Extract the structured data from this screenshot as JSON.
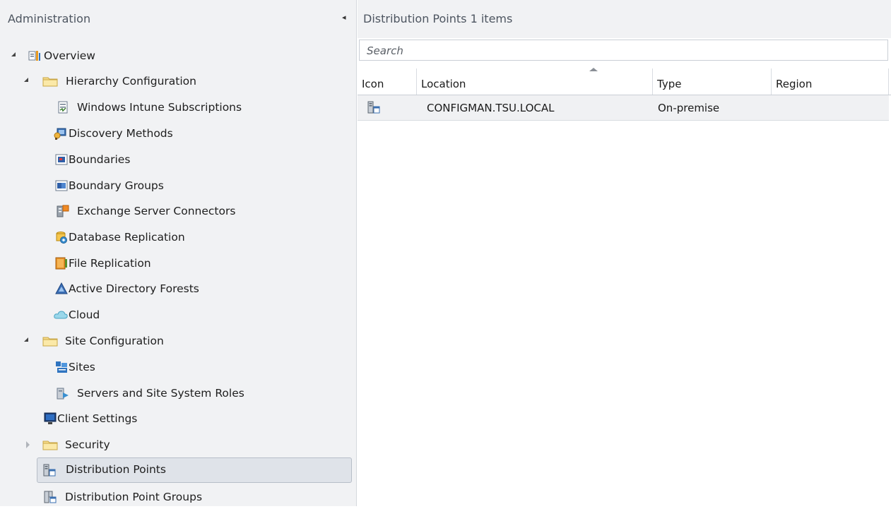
{
  "nav": {
    "title": "Administration",
    "collapse_glyph": "◂",
    "tree": [
      {
        "label": "Overview",
        "icon": "overview-icon",
        "expander": "open"
      },
      {
        "label": "Hierarchy Configuration",
        "icon": "folder-icon",
        "expander": "open"
      },
      {
        "label": "Windows Intune Subscriptions",
        "icon": "subscription-icon"
      },
      {
        "label": "Discovery Methods",
        "icon": "discovery-icon"
      },
      {
        "label": "Boundaries",
        "icon": "boundary-icon"
      },
      {
        "label": "Boundary Groups",
        "icon": "boundary-group-icon"
      },
      {
        "label": "Exchange Server Connectors",
        "icon": "exchange-connector-icon"
      },
      {
        "label": "Database Replication",
        "icon": "database-replication-icon"
      },
      {
        "label": "File Replication",
        "icon": "file-replication-icon"
      },
      {
        "label": "Active Directory Forests",
        "icon": "ad-forest-icon"
      },
      {
        "label": "Cloud",
        "icon": "cloud-icon"
      },
      {
        "label": "Site Configuration",
        "icon": "folder-icon",
        "expander": "open"
      },
      {
        "label": "Sites",
        "icon": "sites-icon"
      },
      {
        "label": "Servers and Site System Roles",
        "icon": "server-roles-icon"
      },
      {
        "label": "Client Settings",
        "icon": "client-settings-icon"
      },
      {
        "label": "Security",
        "icon": "folder-icon",
        "expander": "closed"
      },
      {
        "label": "Distribution Points",
        "icon": "distribution-point-icon",
        "selected": true
      },
      {
        "label": "Distribution Point Groups",
        "icon": "distribution-point-group-icon"
      }
    ]
  },
  "content": {
    "title": "Distribution Points 1 items",
    "search_placeholder": "Search",
    "columns": [
      "Icon",
      "Location",
      "Type",
      "Region"
    ],
    "sorted_column": "Location",
    "rows": [
      {
        "icon": "distribution-point-icon",
        "location": "CONFIGMAN.TSU.LOCAL",
        "type": "On-premise",
        "region": ""
      }
    ]
  },
  "colors": {
    "pane_background": "#f1f2f4",
    "selection_background": "#dfe3e9",
    "header_text": "#4d5560"
  }
}
